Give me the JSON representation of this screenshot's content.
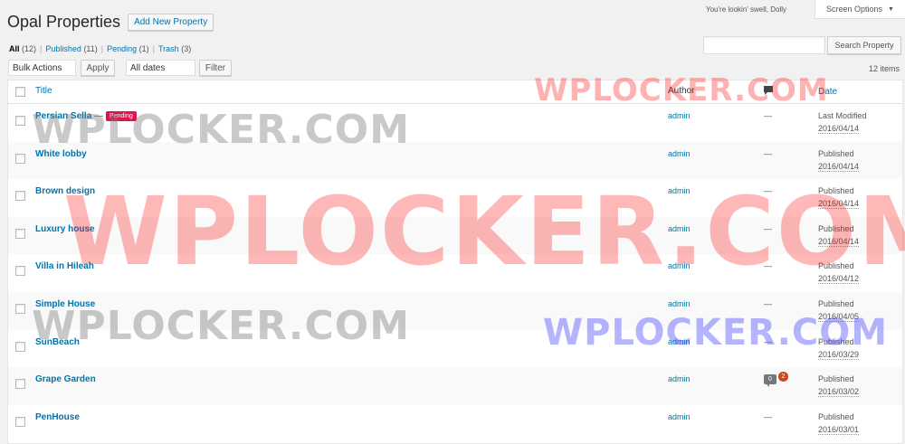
{
  "header": {
    "title": "Opal Properties",
    "add_new_label": "Add New Property",
    "howdy": "You're lookin' swell, Dolly",
    "screen_options": "Screen Options"
  },
  "views": [
    {
      "label": "All",
      "count": "(12)",
      "current": true
    },
    {
      "label": "Published",
      "count": "(11)"
    },
    {
      "label": "Pending",
      "count": "(1)"
    },
    {
      "label": "Trash",
      "count": "(3)"
    }
  ],
  "search": {
    "button_label": "Search Property",
    "value": ""
  },
  "tablenav": {
    "bulk_actions": "Bulk Actions",
    "apply": "Apply",
    "dates": "All dates",
    "filter": "Filter",
    "items_count": "12 items"
  },
  "table": {
    "columns": {
      "title": "Title",
      "author": "Author",
      "date": "Date"
    },
    "rows": [
      {
        "title": "Persian Sella",
        "title_suffix": " —",
        "badge": "Pending",
        "author": "admin",
        "comments": "—",
        "date_status": "Last Modified",
        "date": "2016/04/14"
      },
      {
        "title": "White lobby",
        "author": "admin",
        "comments": "—",
        "date_status": "Published",
        "date": "2016/04/14"
      },
      {
        "title": "Brown design",
        "author": "admin",
        "comments": "—",
        "date_status": "Published",
        "date": "2016/04/14"
      },
      {
        "title": "Luxury house",
        "author": "admin",
        "comments": "—",
        "date_status": "Published",
        "date": "2016/04/14"
      },
      {
        "title": "Villa in Hileah",
        "author": "admin",
        "comments": "—",
        "date_status": "Published",
        "date": "2016/04/12"
      },
      {
        "title": "Simple House",
        "author": "admin",
        "comments": "—",
        "date_status": "Published",
        "date": "2016/04/05"
      },
      {
        "title": "SunBeach",
        "author": "admin",
        "comments": "—",
        "date_status": "Published",
        "date": "2016/03/29"
      },
      {
        "title": "Grape Garden",
        "author": "admin",
        "comment_count": "0",
        "comment_pending": "2",
        "date_status": "Published",
        "date": "2016/03/02"
      },
      {
        "title": "PenHouse",
        "author": "admin",
        "comments": "—",
        "date_status": "Published",
        "date": "2016/03/01"
      }
    ]
  },
  "watermarks": [
    "WPLOCKER.COM",
    "WPLOCKER.COM",
    "WPLOCKER.COM",
    "WPLOCKER.COM",
    "WPLOCKER.COM"
  ]
}
